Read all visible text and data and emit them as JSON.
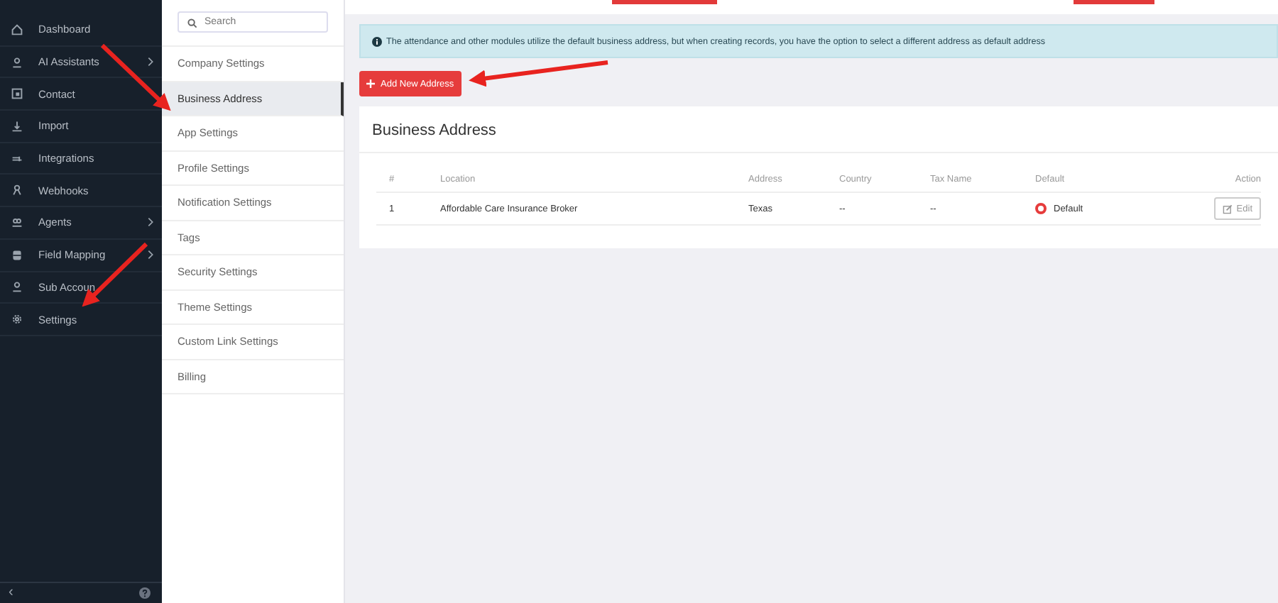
{
  "sidebar": {
    "items": [
      {
        "label": "Dashboard",
        "has_submenu": false
      },
      {
        "label": "AI Assistants",
        "has_submenu": true
      },
      {
        "label": "Contact",
        "has_submenu": false
      },
      {
        "label": "Import",
        "has_submenu": false
      },
      {
        "label": "Integrations",
        "has_submenu": false
      },
      {
        "label": "Webhooks",
        "has_submenu": false
      },
      {
        "label": "Agents",
        "has_submenu": true
      },
      {
        "label": "Field Mapping",
        "has_submenu": true
      },
      {
        "label": "Sub Accoun",
        "has_submenu": false
      },
      {
        "label": "Settings",
        "has_submenu": false
      }
    ],
    "collapse": "‹"
  },
  "settings_menu": {
    "search": {
      "placeholder": "Search"
    },
    "items": [
      {
        "label": "Company Settings",
        "selected": false
      },
      {
        "label": "Business Address",
        "selected": true
      },
      {
        "label": "App Settings",
        "selected": false
      },
      {
        "label": "Profile Settings",
        "selected": false
      },
      {
        "label": "Notification Settings",
        "selected": false
      },
      {
        "label": "Tags",
        "selected": false
      },
      {
        "label": "Security Settings",
        "selected": false
      },
      {
        "label": "Theme Settings",
        "selected": false
      },
      {
        "label": "Custom Link Settings",
        "selected": false
      },
      {
        "label": "Billing",
        "selected": false
      }
    ]
  },
  "alert": "The attendance and other modules utilize the default business address, but when creating records, you have the option to select a different address as default address",
  "add_button": "Add New Address",
  "card": {
    "title": "Business Address",
    "table": {
      "columns": [
        "#",
        "Location",
        "Address",
        "Country",
        "Tax Name",
        "Default",
        "Action"
      ],
      "rows": [
        {
          "number": "1",
          "location": "Affordable Care Insurance Broker",
          "address": "Texas",
          "country": "--",
          "tax_name": "--",
          "default_label": "Default",
          "default_selected": true,
          "action": "Edit"
        }
      ]
    }
  }
}
